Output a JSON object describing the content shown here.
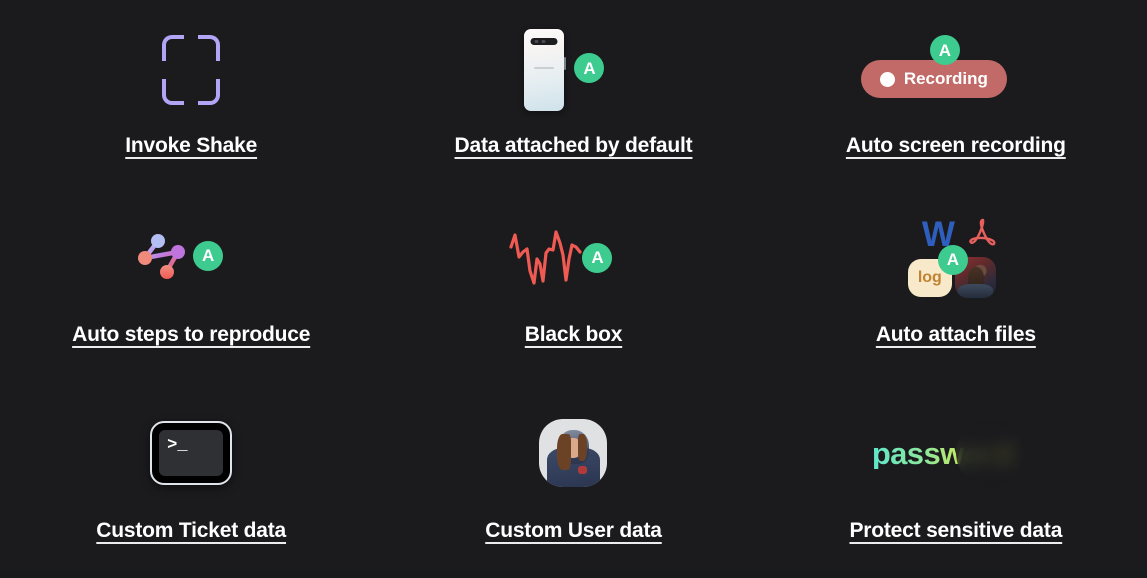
{
  "theme": {
    "background": "#1b1b1e",
    "label_color": "#ffffff",
    "accent_green": "#3dcb8f",
    "accent_purple": "#b3a5f5",
    "accent_red": "#e8605c",
    "recording_pill": "#c16a68",
    "word_blue": "#2f5fbe",
    "log_badge_bg": "#f7e9c9",
    "log_badge_text": "#c08334",
    "password_gradient_start": "#5fe7c9",
    "password_gradient_end": "#e9e944"
  },
  "badges": {
    "automatic_label": "A",
    "recording_label": "Recording",
    "log_label": "log",
    "word_label": "W",
    "terminal_prompt": ">_"
  },
  "features": [
    {
      "id": "invoke-shake",
      "label": "Invoke Shake",
      "icon": "scan-frame-icon",
      "has_auto_badge": false
    },
    {
      "id": "data-attached-by-default",
      "label": "Data attached by default",
      "icon": "smartphone-icon",
      "has_auto_badge": true
    },
    {
      "id": "auto-screen-recording",
      "label": "Auto screen recording",
      "icon": "recording-pill-icon",
      "has_auto_badge": true
    },
    {
      "id": "auto-steps-to-reproduce",
      "label": "Auto steps to reproduce",
      "icon": "node-graph-icon",
      "has_auto_badge": true
    },
    {
      "id": "black-box",
      "label": "Black box",
      "icon": "waveform-icon",
      "has_auto_badge": true
    },
    {
      "id": "auto-attach-files",
      "label": "Auto attach files",
      "icon": "attached-files-icon",
      "has_auto_badge": true
    },
    {
      "id": "custom-ticket-data",
      "label": "Custom Ticket data",
      "icon": "terminal-icon",
      "has_auto_badge": false
    },
    {
      "id": "custom-user-data",
      "label": "Custom User data",
      "icon": "user-avatar-icon",
      "has_auto_badge": false
    },
    {
      "id": "protect-sensitive-data",
      "label": "Protect sensitive data",
      "icon": "password-redaction-icon",
      "has_auto_badge": false,
      "obscured_text": "password"
    }
  ]
}
